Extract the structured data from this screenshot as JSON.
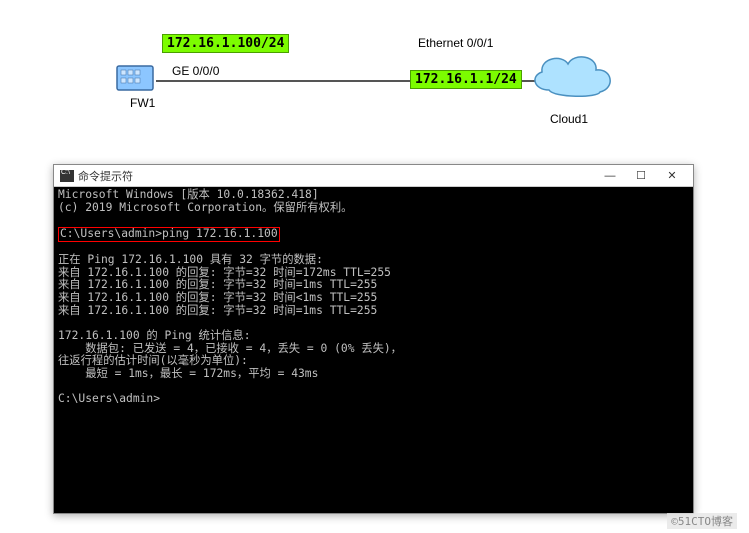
{
  "topology": {
    "fw_label": "FW1",
    "cloud_label": "Cloud1",
    "ge_label": "GE 0/0/0",
    "eth_label": "Ethernet 0/0/1",
    "ip_left": "172.16.1.100/24",
    "ip_right": "172.16.1.1/24"
  },
  "terminal": {
    "title": "命令提示符",
    "min_label": "―",
    "max_label": "☐",
    "close_label": "✕",
    "lines": {
      "l0": "Microsoft Windows [版本 10.0.18362.418]",
      "l1": "(c) 2019 Microsoft Corporation。保留所有权利。",
      "l2": "",
      "prompt_cmd": "C:\\Users\\admin>ping 172.16.1.100",
      "l3": "",
      "l4": "正在 Ping 172.16.1.100 具有 32 字节的数据:",
      "l5": "来自 172.16.1.100 的回复: 字节=32 时间=172ms TTL=255",
      "l6": "来自 172.16.1.100 的回复: 字节=32 时间=1ms TTL=255",
      "l7": "来自 172.16.1.100 的回复: 字节=32 时间<1ms TTL=255",
      "l8": "来自 172.16.1.100 的回复: 字节=32 时间=1ms TTL=255",
      "l9": "",
      "l10": "172.16.1.100 的 Ping 统计信息:",
      "l11": "    数据包: 已发送 = 4，已接收 = 4，丢失 = 0 (0% 丢失)，",
      "l12": "往返行程的估计时间(以毫秒为单位):",
      "l13": "    最短 = 1ms，最长 = 172ms，平均 = 43ms",
      "l14": "",
      "prompt2": "C:\\Users\\admin>"
    }
  },
  "watermark": "©51CTO博客"
}
